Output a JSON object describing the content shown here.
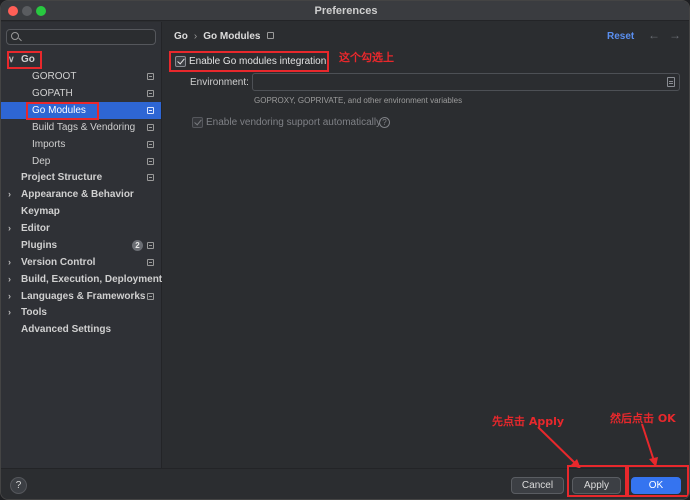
{
  "window": {
    "title": "Preferences"
  },
  "search": {
    "placeholder": ""
  },
  "sidebar": {
    "items": [
      {
        "label": "Go",
        "arrow": "∨"
      },
      {
        "label": "GOROOT"
      },
      {
        "label": "GOPATH"
      },
      {
        "label": "Go Modules"
      },
      {
        "label": "Build Tags & Vendoring"
      },
      {
        "label": "Imports"
      },
      {
        "label": "Dep"
      },
      {
        "label": "Project Structure"
      },
      {
        "label": "Appearance & Behavior",
        "arrow": "›"
      },
      {
        "label": "Keymap"
      },
      {
        "label": "Editor",
        "arrow": "›"
      },
      {
        "label": "Plugins",
        "badge": "2"
      },
      {
        "label": "Version Control",
        "arrow": "›"
      },
      {
        "label": "Build, Execution, Deployment",
        "arrow": "›"
      },
      {
        "label": "Languages & Frameworks",
        "arrow": "›"
      },
      {
        "label": "Tools",
        "arrow": "›"
      },
      {
        "label": "Advanced Settings"
      }
    ]
  },
  "header": {
    "crumb_root": "Go",
    "crumb_sep": "›",
    "crumb_page": "Go Modules",
    "reset": "Reset",
    "back": "←",
    "forward": "→"
  },
  "settings": {
    "enable_integration": {
      "label": "Enable Go modules integration",
      "checked": true
    },
    "environment": {
      "label": "Environment:",
      "value": "",
      "hint": "GOPROXY, GOPRIVATE, and other environment variables"
    },
    "vendoring": {
      "label": "Enable vendoring support automatically",
      "checked": true,
      "disabled": true,
      "help": "?"
    }
  },
  "annotations": {
    "check_this": "这个勾选上",
    "click_apply": "先点击 Apply",
    "click_ok": "然后点击 OK"
  },
  "footer": {
    "help": "?",
    "cancel": "Cancel",
    "apply": "Apply",
    "ok": "OK"
  },
  "colors": {
    "accent": "#3574f0",
    "selection": "#2e66d4",
    "annotation": "#e8282c",
    "link": "#5a8ff0"
  }
}
